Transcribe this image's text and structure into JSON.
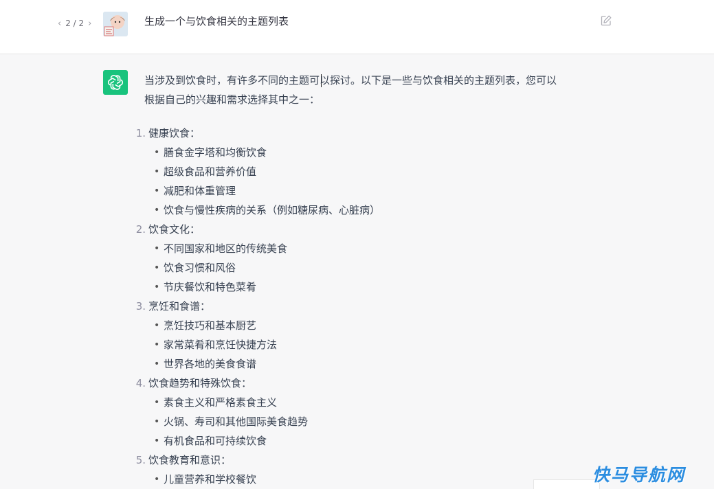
{
  "user_message": {
    "pager": {
      "prev_icon": "chevron-left-icon",
      "count": "2 / 2",
      "next_icon": "chevron-right-icon"
    },
    "text": "生成一个与饮食相关的主题列表",
    "edit_icon": "pencil-square-icon"
  },
  "assistant_message": {
    "intro_line1": "当涉及到饮食时，有许多不同的主题可以探讨。以下是一些与饮食相关的主题列表，您可以",
    "intro_line2": "根据自己的兴趣和需求选择其中之一：",
    "topics": [
      {
        "num": "1.",
        "title": "健康饮食：",
        "items": [
          "膳食金字塔和均衡饮食",
          "超级食品和营养价值",
          "减肥和体重管理",
          "饮食与慢性疾病的关系（例如糖尿病、心脏病）"
        ]
      },
      {
        "num": "2.",
        "title": "饮食文化：",
        "items": [
          "不同国家和地区的传统美食",
          "饮食习惯和风俗",
          "节庆餐饮和特色菜肴"
        ]
      },
      {
        "num": "3.",
        "title": "烹饪和食谱：",
        "items": [
          "烹饪技巧和基本厨艺",
          "家常菜肴和烹饪快捷方法",
          "世界各地的美食食谱"
        ]
      },
      {
        "num": "4.",
        "title": "饮食趋势和特殊饮食：",
        "items": [
          "素食主义和严格素食主义",
          "火锅、寿司和其他国际美食趋势",
          "有机食品和可持续饮食"
        ]
      },
      {
        "num": "5.",
        "title": "饮食教育和意识：",
        "items": [
          "儿童营养和学校餐饮"
        ]
      }
    ]
  },
  "watermark": "快马导航网",
  "colors": {
    "accent": "#19c37d",
    "watermark": "#2b8de0",
    "background": "#f7f7f8"
  }
}
